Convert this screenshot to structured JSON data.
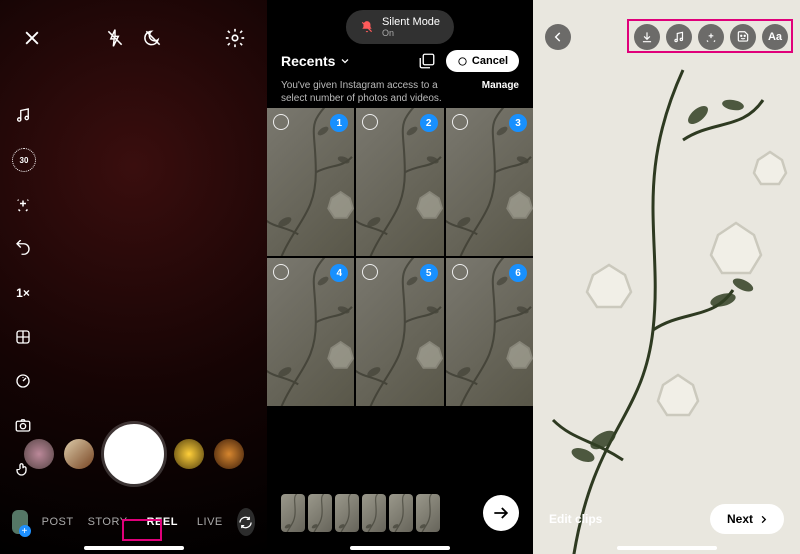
{
  "panel1": {
    "timer_label": "30",
    "zoom_label": "1×",
    "modes": {
      "post": "POST",
      "story": "STORY",
      "reel": "REEL",
      "live": "LIVE"
    }
  },
  "panel2": {
    "notification": {
      "title": "Silent Mode",
      "subtitle": "On"
    },
    "recents_label": "Recents",
    "cancel_label": "Cancel",
    "permission_text": "You've given Instagram access to a select number of photos and videos.",
    "manage_label": "Manage",
    "grid_badges": [
      "1",
      "2",
      "3",
      "4",
      "5",
      "6"
    ],
    "clip_count": 6
  },
  "panel3": {
    "edit_label": "Edit clips",
    "next_label": "Next"
  }
}
